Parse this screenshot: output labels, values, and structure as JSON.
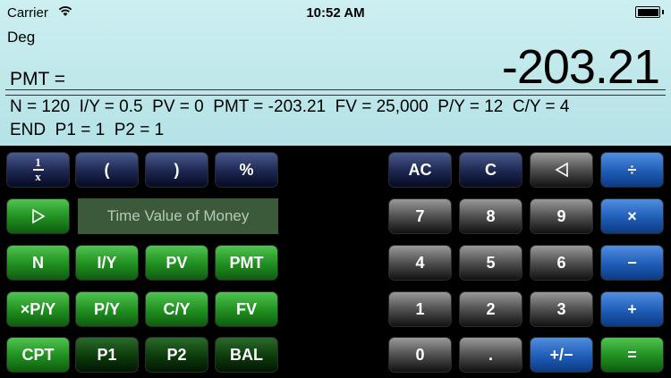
{
  "status": {
    "carrier": "Carrier",
    "time": "10:52 AM"
  },
  "display": {
    "mode": "Deg",
    "register_label": "PMT =",
    "value": "-203.21",
    "params_line1": "N = 120  I/Y = 0.5  PV = 0  PMT = -203.21  FV = 25,000  P/Y = 12  C/Y = 4",
    "params_line2": "END  P1 = 1  P2 = 1"
  },
  "keys": {
    "reciprocal_num": "1",
    "reciprocal_den": "x",
    "open_paren": "(",
    "close_paren": ")",
    "percent": "%",
    "tvm_title": "Time Value of Money",
    "n": "N",
    "iy": "I/Y",
    "pv": "PV",
    "pmt": "PMT",
    "xpy": "×P/Y",
    "py": "P/Y",
    "cy": "C/Y",
    "fv": "FV",
    "cpt": "CPT",
    "p1": "P1",
    "p2": "P2",
    "bal": "BAL",
    "ac": "AC",
    "c": "C",
    "divide": "÷",
    "d7": "7",
    "d8": "8",
    "d9": "9",
    "multiply": "×",
    "d4": "4",
    "d5": "5",
    "d6": "6",
    "minus": "−",
    "d1": "1",
    "d2": "2",
    "d3": "3",
    "plus": "+",
    "d0": "0",
    "dot": ".",
    "sign": "+/−",
    "equals": "="
  },
  "icons": {
    "wifi": "wifi-icon",
    "battery": "battery-icon",
    "play": "play-icon",
    "backspace": "backspace-icon"
  }
}
